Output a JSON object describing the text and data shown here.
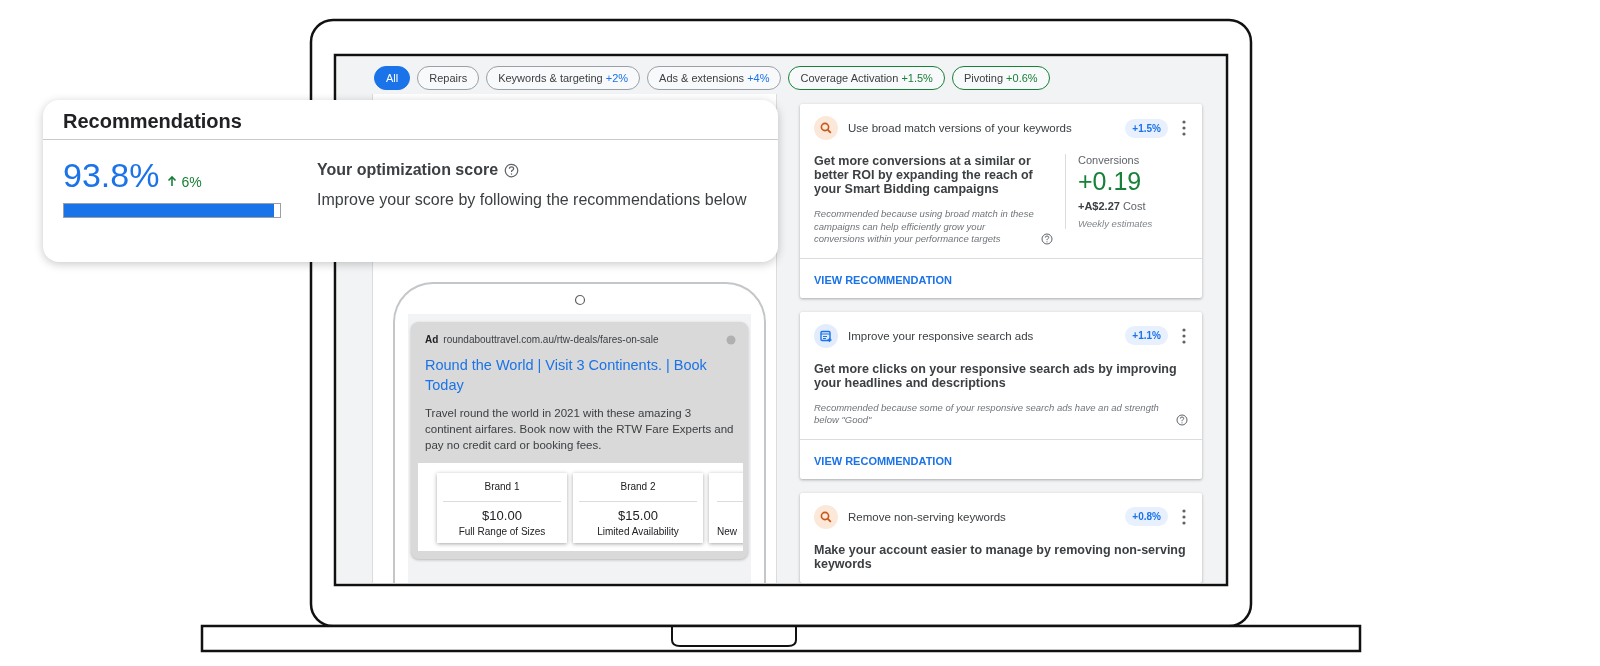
{
  "filters": [
    {
      "label": "All",
      "selected": true,
      "kind": "plain"
    },
    {
      "label": "Repairs",
      "selected": false,
      "kind": "plain"
    },
    {
      "label": "Keywords & targeting",
      "delta": "+2%",
      "selected": false,
      "kind": "plain"
    },
    {
      "label": "Ads & extensions",
      "delta": "+4%",
      "selected": false,
      "kind": "plain"
    },
    {
      "label": "Coverage Activation",
      "delta": "+1.5%",
      "selected": false,
      "kind": "highlight"
    },
    {
      "label": "Pivoting",
      "delta": "+0.6%",
      "selected": false,
      "kind": "highlight"
    }
  ],
  "score_card": {
    "title": "Recommendations",
    "score": "93.8%",
    "change": "6%",
    "level": 0.97,
    "heading": "Your optimization score",
    "description": "Improve your score by following the recommendations below"
  },
  "ad_preview": {
    "label": "Ad",
    "url": "roundabouttravel.com.au/rtw-deals/fares-on-sale",
    "headline": "Round the World | Visit 3 Continents. | Book Today",
    "description": "Travel round the world in 2021 with these amazing 3 continent airfares. Book now with the RTW Fare Experts and pay no credit card or booking fees.",
    "products": [
      {
        "brand": "Brand 1",
        "price": "$10.00",
        "note": "Full Range of Sizes"
      },
      {
        "brand": "Brand 2",
        "price": "$15.00",
        "note": "Limited Availability"
      },
      {
        "note": "New"
      }
    ]
  },
  "recommendations": [
    {
      "kind": "search",
      "title": "Use broad match versions of your keywords",
      "uplift": "+1.5%",
      "headline": "Get more conversions at a similar or better ROI by expanding the reach of your Smart Bidding campaigns",
      "reason": "Recommended because using broad match in these campaigns can help efficiently grow your conversions within your performance targets",
      "metric": {
        "label": "Conversions",
        "value": "+0.19",
        "cost": "+A$2.27",
        "cost_label": "Cost",
        "note": "Weekly estimates"
      },
      "action": "VIEW RECOMMENDATION"
    },
    {
      "kind": "ads",
      "title": "Improve your responsive search ads",
      "uplift": "+1.1%",
      "headline": "Get more clicks on your responsive search ads by improving your headlines and descriptions",
      "reason": "Recommended because some of your responsive search ads have an ad strength below \"Good\"",
      "action": "VIEW RECOMMENDATION"
    },
    {
      "kind": "search",
      "title": "Remove non-serving keywords",
      "uplift": "+0.8%",
      "headline": "Make your account easier to manage by removing non-serving keywords"
    }
  ]
}
